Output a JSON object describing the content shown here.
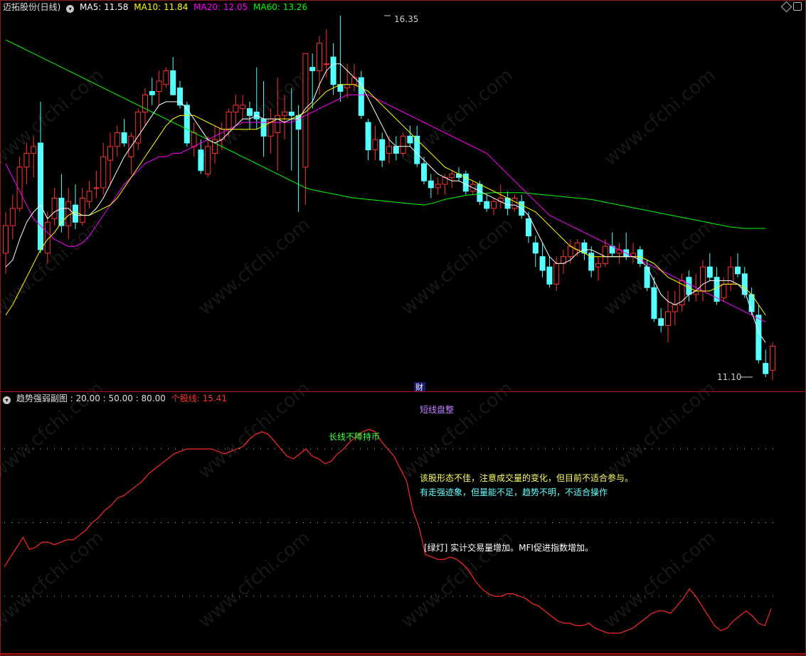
{
  "main_header": {
    "title": "迈拓股份(日线)",
    "ma5_label": "MA5: 11.58",
    "ma10_label": "MA10: 11.84",
    "ma20_label": "MA20: 12.05",
    "ma60_label": "MA60: 13.26",
    "colors": {
      "title": "#e0e0e0",
      "ma5": "#ffffff",
      "ma10": "#ffff00",
      "ma20": "#ff00ff",
      "ma60": "#00ff00"
    }
  },
  "sub_header": {
    "title": "趋势强弱副图 : 20.00 : 50.00 : 80.00",
    "stock_line_label": "个股线: 15.41",
    "colors": {
      "title": "#e0e0e0",
      "stock_line": "#ff3030"
    }
  },
  "annotations": {
    "high_price": "16.35",
    "low_price": "11.10",
    "finance_marker": "财",
    "short_line": "短线盘整",
    "long_line": "长线不降持币",
    "comment_1": "该股形态不佳，注意成交量的变化，但目前不适合参与。",
    "comment_2": "有走强迹象，但量能不足，趋势不明，不适合操作",
    "comment_3": "[绿灯] 实计交易量增加。MFI促进指数增加。"
  },
  "watermark": "www.cfchi.com",
  "chart_data": [
    {
      "type": "candlestick",
      "title": "迈拓股份(日线)",
      "price_range": [
        11.1,
        16.35
      ],
      "up_color": "#ff3232",
      "down_color": "#54ffff",
      "candles": [
        [
          12.9,
          13.5,
          12.6,
          13.3
        ],
        [
          13.3,
          13.75,
          13.1,
          13.55
        ],
        [
          13.55,
          14.3,
          13.5,
          14.15
        ],
        [
          14.15,
          14.5,
          13.9,
          14.35
        ],
        [
          14.35,
          14.6,
          14.0,
          14.45
        ],
        [
          14.5,
          15.1,
          12.9,
          12.95
        ],
        [
          12.9,
          13.5,
          12.75,
          13.35
        ],
        [
          13.4,
          13.85,
          13.3,
          13.7
        ],
        [
          13.7,
          14.05,
          13.2,
          13.3
        ],
        [
          13.3,
          13.85,
          13.1,
          13.65
        ],
        [
          13.6,
          13.9,
          13.25,
          13.35
        ],
        [
          13.35,
          13.85,
          13.3,
          13.7
        ],
        [
          13.65,
          13.95,
          13.55,
          13.8
        ],
        [
          13.85,
          14.1,
          13.7,
          13.85
        ],
        [
          13.85,
          14.5,
          13.75,
          14.3
        ],
        [
          14.25,
          14.65,
          13.9,
          14.45
        ],
        [
          14.45,
          14.75,
          14.3,
          14.65
        ],
        [
          14.65,
          14.85,
          14.45,
          14.5
        ],
        [
          14.3,
          14.65,
          14.05,
          14.6
        ],
        [
          14.5,
          15.0,
          14.4,
          14.95
        ],
        [
          14.95,
          15.3,
          14.75,
          15.2
        ],
        [
          15.25,
          15.45,
          15.05,
          15.2
        ],
        [
          15.25,
          15.55,
          15.05,
          15.4
        ],
        [
          15.35,
          15.6,
          15.3,
          15.55
        ],
        [
          15.55,
          15.75,
          15.2,
          15.2
        ],
        [
          15.3,
          15.4,
          15.0,
          15.05
        ],
        [
          15.05,
          15.1,
          14.45,
          14.5
        ],
        [
          14.45,
          14.8,
          14.3,
          14.65
        ],
        [
          14.4,
          14.55,
          14.05,
          14.1
        ],
        [
          14.05,
          14.6,
          14.0,
          14.45
        ],
        [
          14.35,
          14.75,
          14.2,
          14.55
        ],
        [
          14.55,
          14.8,
          14.4,
          14.7
        ],
        [
          14.7,
          15.0,
          14.6,
          14.95
        ],
        [
          14.95,
          15.2,
          14.75,
          15.05
        ],
        [
          15.0,
          15.2,
          14.85,
          15.05
        ],
        [
          15.0,
          15.1,
          14.7,
          14.9
        ],
        [
          14.95,
          15.6,
          14.7,
          14.85
        ],
        [
          14.85,
          15.4,
          14.3,
          14.6
        ],
        [
          14.6,
          15.0,
          14.35,
          14.85
        ],
        [
          14.65,
          15.45,
          14.1,
          14.9
        ],
        [
          14.9,
          15.2,
          14.55,
          14.95
        ],
        [
          14.95,
          15.3,
          14.1,
          14.9
        ],
        [
          14.9,
          15.05,
          13.5,
          14.7
        ],
        [
          14.15,
          15.8,
          13.6,
          15.8
        ],
        [
          15.6,
          15.8,
          15.0,
          15.55
        ],
        [
          15.55,
          16.05,
          15.2,
          15.95
        ],
        [
          15.65,
          16.15,
          15.45,
          15.65
        ],
        [
          15.75,
          15.95,
          15.2,
          15.35
        ],
        [
          15.35,
          16.35,
          15.1,
          15.25
        ],
        [
          15.3,
          15.65,
          15.15,
          15.35
        ],
        [
          15.35,
          15.65,
          15.25,
          15.45
        ],
        [
          15.45,
          15.55,
          14.85,
          14.9
        ],
        [
          14.8,
          14.85,
          14.25,
          14.4
        ],
        [
          14.4,
          14.75,
          14.25,
          14.55
        ],
        [
          14.55,
          14.65,
          14.15,
          14.25
        ],
        [
          14.35,
          14.6,
          14.2,
          14.45
        ],
        [
          14.45,
          14.6,
          14.25,
          14.35
        ],
        [
          14.35,
          14.65,
          14.3,
          14.6
        ],
        [
          14.6,
          14.75,
          14.45,
          14.5
        ],
        [
          14.6,
          14.75,
          14.15,
          14.2
        ],
        [
          14.2,
          14.3,
          13.9,
          13.95
        ],
        [
          13.95,
          14.05,
          13.7,
          13.85
        ],
        [
          13.85,
          14.0,
          13.75,
          13.9
        ],
        [
          13.9,
          14.05,
          13.75,
          14.0
        ],
        [
          14.0,
          14.1,
          13.85,
          14.05
        ],
        [
          14.05,
          14.15,
          13.95,
          14.0
        ],
        [
          14.05,
          14.1,
          13.75,
          13.8
        ],
        [
          13.8,
          13.95,
          13.75,
          13.9
        ],
        [
          13.9,
          13.95,
          13.6,
          13.65
        ],
        [
          13.65,
          13.75,
          13.5,
          13.55
        ],
        [
          13.55,
          13.7,
          13.45,
          13.65
        ],
        [
          13.65,
          13.9,
          13.55,
          13.7
        ],
        [
          13.7,
          13.8,
          13.45,
          13.55
        ],
        [
          13.55,
          13.75,
          13.5,
          13.7
        ],
        [
          13.65,
          13.75,
          13.4,
          13.45
        ],
        [
          13.4,
          13.5,
          13.05,
          13.15
        ],
        [
          13.05,
          13.15,
          12.7,
          12.9
        ],
        [
          12.85,
          13.05,
          12.55,
          12.65
        ],
        [
          12.7,
          12.85,
          12.4,
          12.45
        ],
        [
          12.45,
          12.85,
          12.35,
          12.75
        ],
        [
          12.75,
          12.95,
          12.6,
          12.85
        ],
        [
          12.85,
          13.1,
          12.75,
          13.0
        ],
        [
          12.95,
          13.1,
          12.85,
          13.05
        ],
        [
          13.05,
          13.1,
          12.8,
          12.9
        ],
        [
          12.9,
          13.0,
          12.55,
          12.65
        ],
        [
          12.7,
          12.85,
          12.5,
          12.75
        ],
        [
          12.75,
          13.1,
          12.7,
          13.0
        ],
        [
          13.0,
          13.2,
          12.85,
          12.9
        ],
        [
          12.9,
          13.05,
          12.75,
          12.95
        ],
        [
          12.95,
          13.2,
          12.8,
          12.85
        ],
        [
          12.85,
          13.05,
          12.75,
          12.9
        ],
        [
          12.95,
          13.0,
          12.7,
          12.75
        ],
        [
          12.7,
          12.8,
          12.35,
          12.4
        ],
        [
          12.4,
          12.55,
          11.9,
          11.95
        ],
        [
          11.95,
          12.1,
          11.75,
          11.85
        ],
        [
          11.85,
          12.35,
          11.6,
          12.05
        ],
        [
          12.05,
          12.35,
          11.85,
          12.15
        ],
        [
          12.15,
          12.6,
          12.05,
          12.5
        ],
        [
          12.55,
          12.65,
          12.2,
          12.3
        ],
        [
          12.3,
          12.6,
          12.2,
          12.35
        ],
        [
          12.35,
          12.8,
          12.2,
          12.7
        ],
        [
          12.7,
          12.9,
          12.5,
          12.55
        ],
        [
          12.55,
          12.7,
          12.15,
          12.2
        ],
        [
          12.25,
          12.55,
          12.2,
          12.45
        ],
        [
          12.45,
          12.85,
          12.35,
          12.7
        ],
        [
          12.7,
          12.9,
          12.55,
          12.6
        ],
        [
          12.6,
          12.7,
          12.25,
          12.3
        ],
        [
          12.3,
          12.4,
          12.0,
          12.05
        ],
        [
          12.0,
          12.15,
          11.3,
          11.35
        ],
        [
          11.3,
          11.5,
          11.1,
          11.15
        ],
        [
          11.2,
          11.6,
          11.05,
          11.55
        ]
      ],
      "ma5": [
        12.7,
        12.8,
        13.1,
        13.35,
        13.5,
        13.6,
        13.4,
        13.5,
        13.55,
        13.55,
        13.45,
        13.45,
        13.45,
        13.55,
        13.7,
        13.9,
        14.1,
        14.3,
        14.45,
        14.6,
        14.75,
        14.9,
        15.05,
        15.1,
        15.1,
        15.1,
        15.0,
        14.85,
        14.7,
        14.55,
        14.5,
        14.55,
        14.65,
        14.75,
        14.85,
        14.85,
        14.9,
        14.85,
        14.85,
        14.85,
        14.8,
        14.85,
        14.85,
        15.0,
        15.1,
        15.35,
        15.55,
        15.65,
        15.65,
        15.55,
        15.45,
        15.35,
        15.15,
        14.95,
        14.75,
        14.55,
        14.45,
        14.45,
        14.45,
        14.35,
        14.25,
        14.15,
        14.05,
        14.0,
        13.95,
        13.95,
        13.9,
        13.85,
        13.8,
        13.75,
        13.7,
        13.65,
        13.6,
        13.6,
        13.55,
        13.45,
        13.25,
        13.05,
        12.85,
        12.75,
        12.75,
        12.8,
        12.9,
        12.95,
        12.95,
        12.9,
        12.85,
        12.85,
        12.85,
        12.85,
        12.85,
        12.8,
        12.7,
        12.5,
        12.3,
        12.2,
        12.15,
        12.2,
        12.3,
        12.35,
        12.45,
        12.5,
        12.5,
        12.5,
        12.5,
        12.45,
        12.35,
        12.05,
        11.75,
        11.6
      ],
      "ma10": [
        12.0,
        12.15,
        12.35,
        12.55,
        12.75,
        12.95,
        13.1,
        13.2,
        13.35,
        13.45,
        13.5,
        13.45,
        13.45,
        13.5,
        13.55,
        13.6,
        13.7,
        13.85,
        14.0,
        14.15,
        14.3,
        14.45,
        14.6,
        14.75,
        14.85,
        14.9,
        14.9,
        14.9,
        14.85,
        14.8,
        14.75,
        14.7,
        14.7,
        14.7,
        14.7,
        14.7,
        14.7,
        14.75,
        14.8,
        14.85,
        14.85,
        14.85,
        14.9,
        14.95,
        15.05,
        15.15,
        15.25,
        15.3,
        15.35,
        15.35,
        15.35,
        15.3,
        15.25,
        15.15,
        15.05,
        14.95,
        14.85,
        14.75,
        14.65,
        14.55,
        14.45,
        14.35,
        14.25,
        14.15,
        14.1,
        14.05,
        14.0,
        13.95,
        13.9,
        13.85,
        13.8,
        13.75,
        13.7,
        13.65,
        13.6,
        13.55,
        13.5,
        13.4,
        13.3,
        13.2,
        13.1,
        13.0,
        12.95,
        12.9,
        12.85,
        12.85,
        12.85,
        12.85,
        12.85,
        12.85,
        12.85,
        12.85,
        12.8,
        12.75,
        12.65,
        12.55,
        12.5,
        12.45,
        12.4,
        12.35,
        12.35,
        12.35,
        12.4,
        12.45,
        12.45,
        12.45,
        12.4,
        12.3,
        12.15,
        12.0
      ],
      "ma20": [
        14.2,
        14.0,
        13.8,
        13.6,
        13.4,
        13.3,
        13.2,
        13.1,
        13.05,
        13.0,
        13.0,
        13.05,
        13.15,
        13.3,
        13.45,
        13.6,
        13.75,
        13.9,
        14.0,
        14.1,
        14.2,
        14.25,
        14.3,
        14.3,
        14.35,
        14.35,
        14.4,
        14.45,
        14.5,
        14.55,
        14.6,
        14.65,
        14.7,
        14.75,
        14.8,
        14.8,
        14.8,
        14.8,
        14.8,
        14.8,
        14.8,
        14.8,
        14.85,
        14.9,
        14.95,
        15.0,
        15.05,
        15.1,
        15.15,
        15.2,
        15.2,
        15.2,
        15.2,
        15.15,
        15.1,
        15.05,
        15.0,
        14.95,
        14.9,
        14.85,
        14.8,
        14.75,
        14.7,
        14.65,
        14.6,
        14.55,
        14.5,
        14.45,
        14.4,
        14.35,
        14.25,
        14.15,
        14.05,
        13.95,
        13.85,
        13.75,
        13.65,
        13.55,
        13.45,
        13.4,
        13.35,
        13.3,
        13.25,
        13.2,
        13.15,
        13.1,
        13.05,
        13.0,
        12.95,
        12.9,
        12.85,
        12.8,
        12.75,
        12.7,
        12.65,
        12.6,
        12.55,
        12.5,
        12.45,
        12.4,
        12.35,
        12.3,
        12.25,
        12.2,
        12.15,
        12.1,
        12.05,
        12.0,
        11.95,
        11.9
      ],
      "ma60": [
        16.0,
        15.95,
        15.9,
        15.85,
        15.8,
        15.75,
        15.7,
        15.65,
        15.6,
        15.55,
        15.5,
        15.45,
        15.4,
        15.35,
        15.3,
        15.25,
        15.2,
        15.15,
        15.1,
        15.05,
        15.0,
        14.95,
        14.9,
        14.85,
        14.8,
        14.75,
        14.7,
        14.65,
        14.6,
        14.55,
        14.5,
        14.45,
        14.4,
        14.35,
        14.3,
        14.25,
        14.2,
        14.15,
        14.1,
        14.05,
        14.0,
        13.95,
        13.9,
        13.85,
        13.82,
        13.8,
        13.78,
        13.76,
        13.74,
        13.72,
        13.7,
        13.69,
        13.68,
        13.67,
        13.66,
        13.65,
        13.64,
        13.63,
        13.62,
        13.61,
        13.6,
        13.62,
        13.65,
        13.68,
        13.7,
        13.72,
        13.74,
        13.75,
        13.76,
        13.77,
        13.78,
        13.78,
        13.78,
        13.78,
        13.78,
        13.77,
        13.76,
        13.75,
        13.74,
        13.73,
        13.72,
        13.71,
        13.7,
        13.69,
        13.68,
        13.66,
        13.64,
        13.62,
        13.6,
        13.58,
        13.56,
        13.54,
        13.52,
        13.5,
        13.48,
        13.46,
        13.44,
        13.42,
        13.4,
        13.38,
        13.36,
        13.34,
        13.32,
        13.3,
        13.28,
        13.27,
        13.26,
        13.26,
        13.26,
        13.26
      ]
    },
    {
      "type": "line",
      "title": "趋势强弱副图",
      "levels": [
        20,
        50,
        80
      ],
      "ylim": [
        0,
        100
      ],
      "series": [
        {
          "name": "个股线",
          "values": [
            32,
            36,
            40,
            44,
            39,
            40,
            42,
            42,
            41,
            42,
            43,
            43,
            45,
            47,
            50,
            52,
            55,
            57,
            60,
            61,
            63,
            65,
            67,
            70,
            72,
            74,
            76,
            78,
            79,
            80,
            80,
            80,
            80,
            80,
            79,
            78,
            79,
            80,
            81,
            84,
            86,
            87,
            86,
            83,
            80,
            77,
            76,
            78,
            80,
            77,
            76,
            74,
            75,
            78,
            80,
            83,
            85,
            87,
            88,
            87,
            83,
            80,
            77,
            72,
            67,
            55,
            48,
            37,
            36,
            35,
            35,
            36,
            35,
            33,
            30,
            26,
            23,
            21,
            20,
            20,
            21,
            21,
            20,
            19,
            17,
            16,
            14,
            12,
            10,
            9,
            9,
            8,
            8,
            9,
            7,
            6,
            5,
            5,
            5,
            6,
            7,
            9,
            11,
            13,
            14,
            14,
            13,
            16,
            19,
            23,
            20,
            16,
            12,
            8,
            6,
            7,
            10,
            12,
            14,
            12,
            9,
            8,
            15
          ]
        }
      ]
    }
  ]
}
